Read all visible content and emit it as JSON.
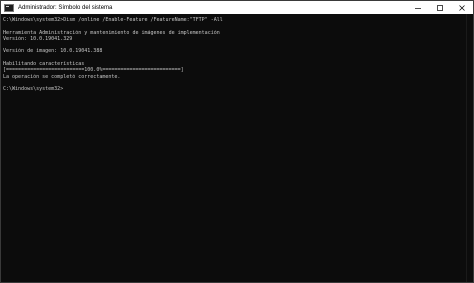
{
  "window": {
    "title": "Administrador: Símbolo del sistema",
    "controls": {
      "minimize_icon": "minimize-icon",
      "maximize_icon": "maximize-icon",
      "close_icon": "close-icon"
    }
  },
  "console": {
    "lines": [
      "C:\\Windows\\system32>Dism /online /Enable-Feature /FeatureName:\"TFTP\" -All",
      "",
      "Herramienta Administración y mantenimiento de imágenes de implementación",
      "Versión: 10.0.19041.329",
      "",
      "Versión de imagen: 10.0.19041.388",
      "",
      "Habilitando características",
      "[==========================100.0%==========================]",
      "La operación se completó correctamente.",
      "",
      "C:\\Windows\\system32>"
    ]
  },
  "colors": {
    "console_bg": "#0c0c0c",
    "console_text": "#c6c6c6",
    "titlebar_bg": "#ffffff"
  }
}
